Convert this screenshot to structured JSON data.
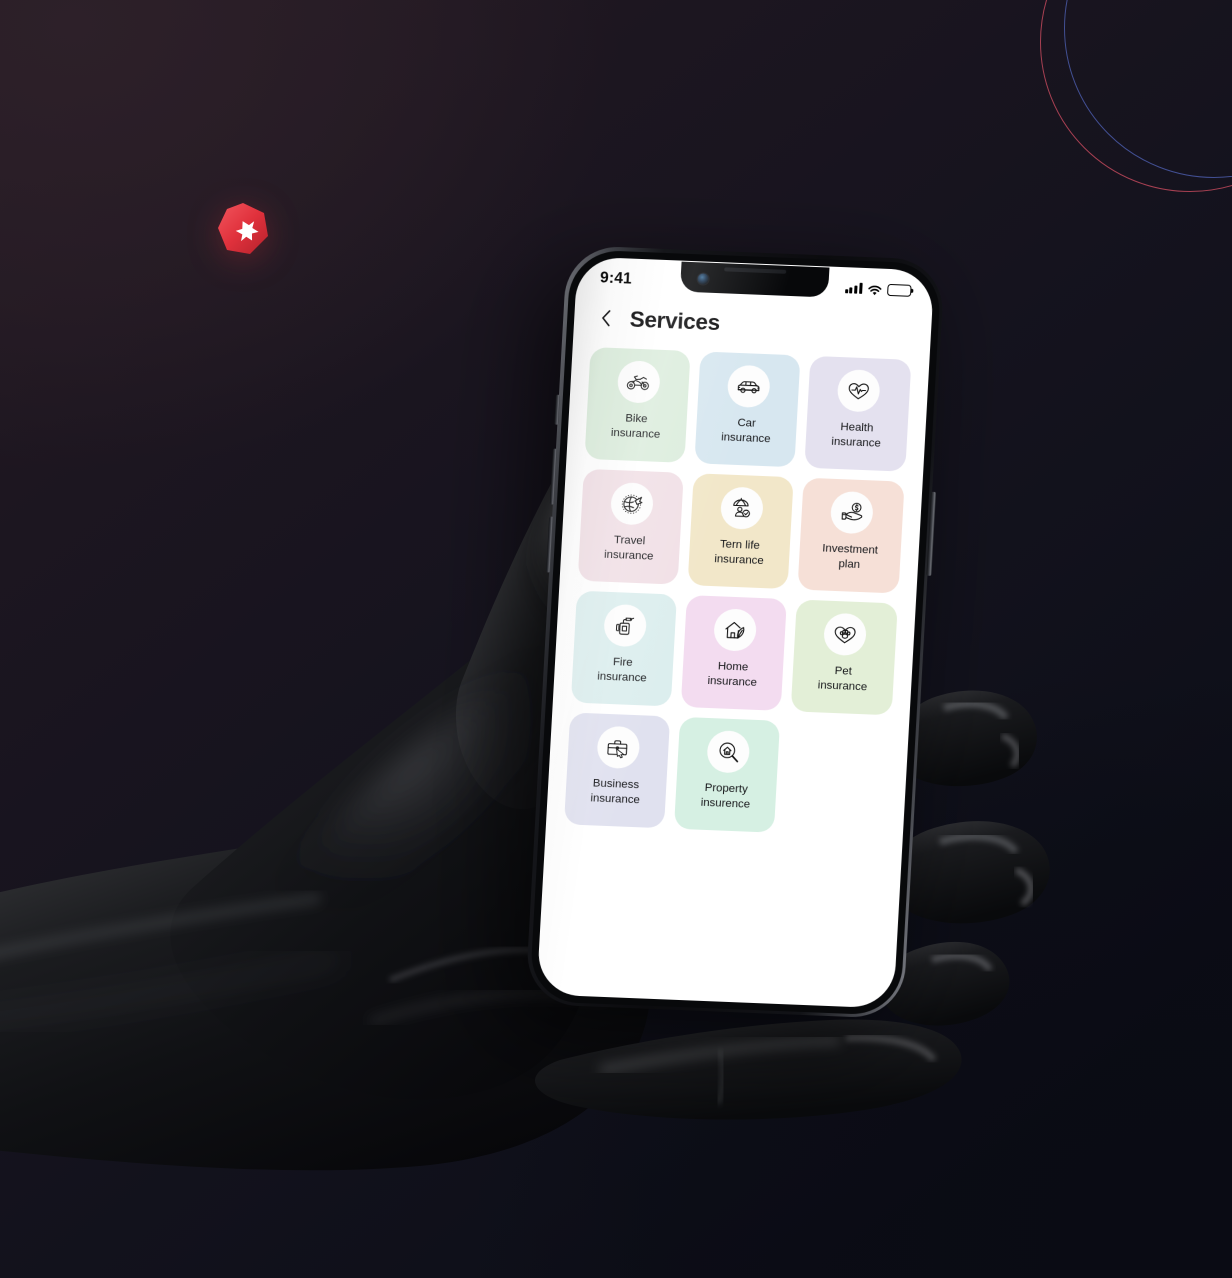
{
  "scene": {
    "background_top_left": "#251a23",
    "background_bottom_right": "#0a0b13",
    "decor": {
      "ring_red_color": "#c74b5e",
      "ring_blue_color": "#4a5ba8",
      "badge_color": "#e8353f",
      "badge_icon": "medical-cross-badge-icon"
    },
    "hand_color": "#0d0d0f"
  },
  "phone": {
    "status_bar": {
      "time": "9:41",
      "signal_icon": "cellular-bars-icon",
      "wifi_icon": "wifi-icon",
      "battery_icon": "battery-full-icon",
      "battery_level": 100
    },
    "header": {
      "back_icon": "chevron-left-icon",
      "title": "Services"
    },
    "services": [
      {
        "label": "Bike\ninsurance",
        "icon": "motorcycle-icon",
        "bg": "#dceddd"
      },
      {
        "label": "Car\ninsurance",
        "icon": "car-icon",
        "bg": "#d7e7f0"
      },
      {
        "label": "Health\ninsurance",
        "icon": "heart-pulse-icon",
        "bg": "#e4e1ef"
      },
      {
        "label": "Travel\ninsurance",
        "icon": "globe-airplane-icon",
        "bg": "#f1e0e6"
      },
      {
        "label": "Tern life\ninsurance",
        "icon": "umbrella-person-icon",
        "bg": "#f2e7c9"
      },
      {
        "label": "Investment\nplan",
        "icon": "hand-coin-icon",
        "bg": "#f6e0d7"
      },
      {
        "label": "Fire\ninsurance",
        "icon": "fire-extinguisher-icon",
        "bg": "#dceeee"
      },
      {
        "label": "Home\ninsurance",
        "icon": "house-leaf-icon",
        "bg": "#f3dcf0"
      },
      {
        "label": "Pet\ninsurance",
        "icon": "heart-paw-icon",
        "bg": "#e3efd7"
      },
      {
        "label": "Business\ninsurance",
        "icon": "briefcase-cursor-icon",
        "bg": "#e0e1ef"
      },
      {
        "label": "Property\ninsurence",
        "icon": "house-magnifier-icon",
        "bg": "#d6f0e3"
      }
    ]
  }
}
